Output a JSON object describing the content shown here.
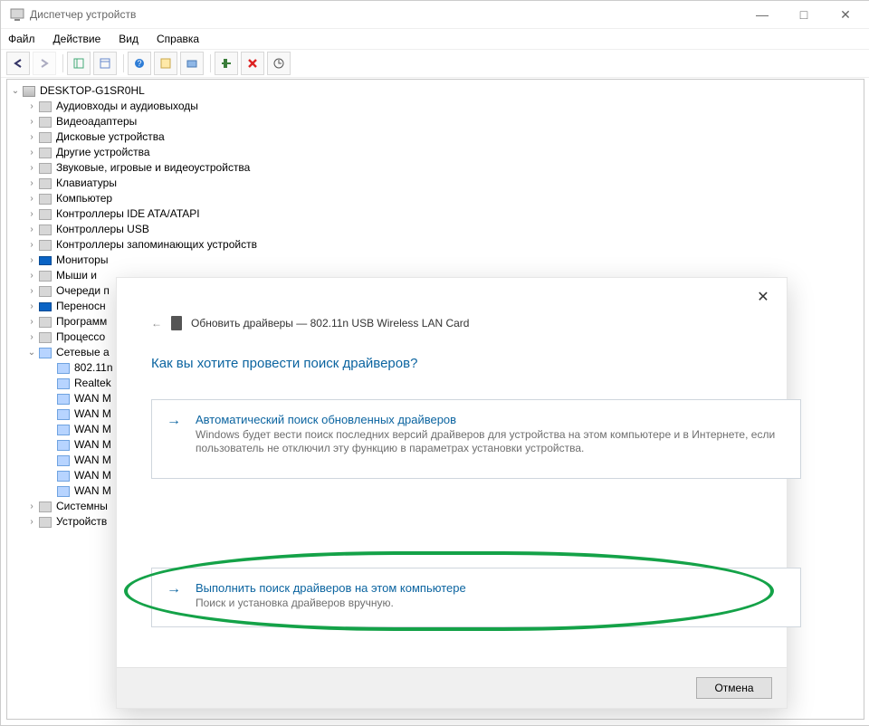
{
  "window": {
    "title": "Диспетчер устройств",
    "buttons": {
      "min": "—",
      "max": "□",
      "close": "✕"
    }
  },
  "menu": {
    "file": "Файл",
    "action": "Действие",
    "view": "Вид",
    "help": "Справка"
  },
  "toolbar": {
    "back": "back-icon",
    "fwd": "fwd-icon",
    "t1": "grid-icon",
    "t2": "list-icon",
    "t3": "help-icon",
    "t4": "props-icon",
    "t5": "monitor-icon",
    "t6": "add-hw-icon",
    "t7": "delete-icon",
    "t8": "scan-icon"
  },
  "tree": {
    "root": "DESKTOP-G1SR0HL",
    "items": [
      {
        "label": "Аудиовходы и аудиовыходы",
        "ic": "ic-gen"
      },
      {
        "label": "Видеоадаптеры",
        "ic": "ic-gen"
      },
      {
        "label": "Дисковые устройства",
        "ic": "ic-gen"
      },
      {
        "label": "Другие устройства",
        "ic": "ic-gen"
      },
      {
        "label": "Звуковые, игровые и видеоустройства",
        "ic": "ic-gen"
      },
      {
        "label": "Клавиатуры",
        "ic": "ic-gen"
      },
      {
        "label": "Компьютер",
        "ic": "ic-gen"
      },
      {
        "label": "Контроллеры IDE ATA/ATAPI",
        "ic": "ic-gen"
      },
      {
        "label": "Контроллеры USB",
        "ic": "ic-gen"
      },
      {
        "label": "Контроллеры запоминающих устройств",
        "ic": "ic-gen"
      },
      {
        "label": "Мониторы",
        "ic": "ic-mon"
      },
      {
        "label": "Мыши и",
        "ic": "ic-gen"
      },
      {
        "label": "Очереди п",
        "ic": "ic-gen"
      },
      {
        "label": "Переносн",
        "ic": "ic-mon"
      },
      {
        "label": "Программ",
        "ic": "ic-gen"
      },
      {
        "label": "Процессо",
        "ic": "ic-gen"
      }
    ],
    "net_label": "Сетевые а",
    "net_children": [
      "802.11n",
      "Realtek",
      "WAN M",
      "WAN M",
      "WAN M",
      "WAN M",
      "WAN M",
      "WAN M",
      "WAN M"
    ],
    "items_after": [
      {
        "label": "Системны",
        "ic": "ic-gen"
      },
      {
        "label": "Устройств",
        "ic": "ic-gen"
      }
    ]
  },
  "dialog": {
    "breadcrumb": "Обновить драйверы — 802.11n USB Wireless LAN Card",
    "question": "Как вы хотите провести поиск драйверов?",
    "opt1_title": "Автоматический поиск обновленных драйверов",
    "opt1_desc": "Windows будет вести поиск последних версий драйверов для устройства на этом компьютере и в Интернете, если пользователь не отключил эту функцию в параметрах установки устройства.",
    "opt2_title": "Выполнить поиск драйверов на этом компьютере",
    "opt2_desc": "Поиск и установка драйверов вручную.",
    "cancel": "Отмена"
  }
}
